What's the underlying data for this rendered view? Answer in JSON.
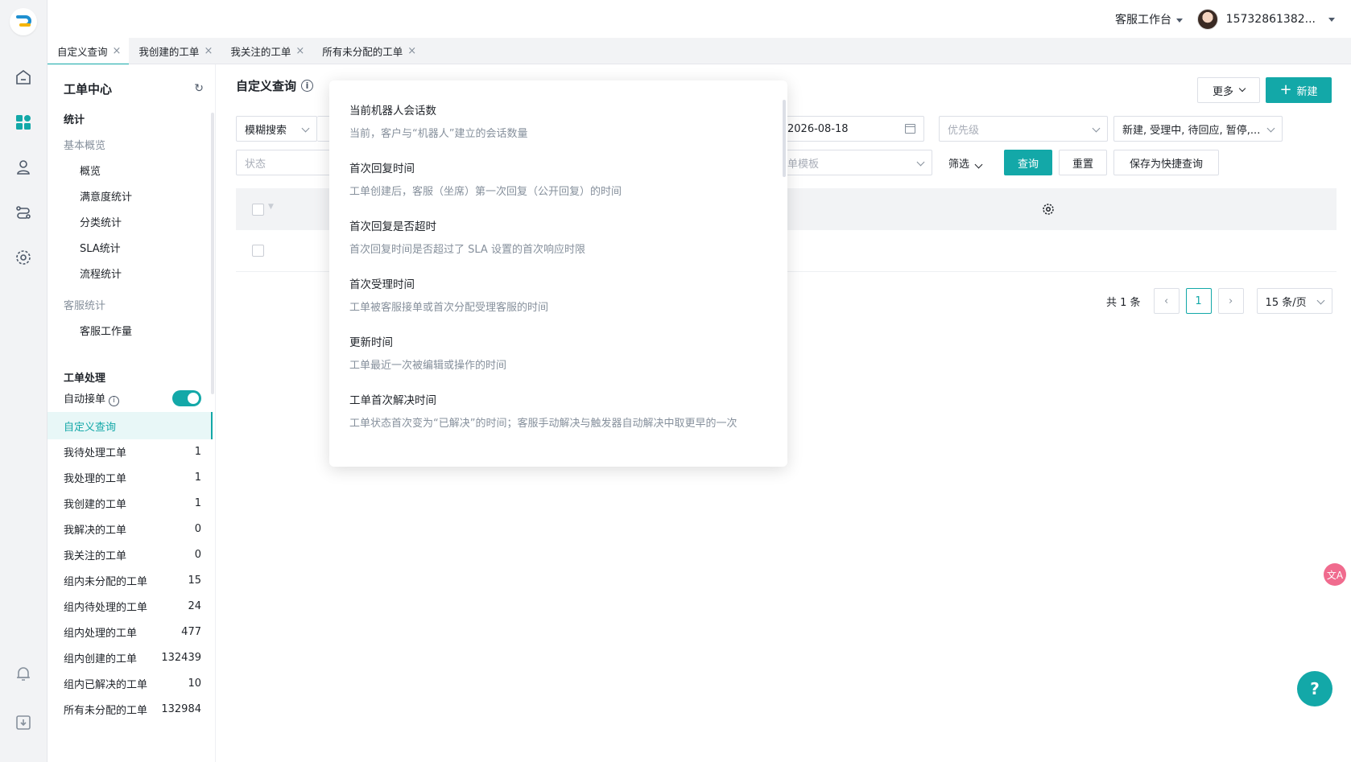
{
  "topbar": {
    "workspace": "客服工作台",
    "user": "15732861382..."
  },
  "tabs": [
    {
      "label": "自定义查询"
    },
    {
      "label": "我创建的工单"
    },
    {
      "label": "我关注的工单"
    },
    {
      "label": "所有未分配的工单"
    }
  ],
  "sidebar": {
    "title": "工单中心",
    "stats_section": "统计",
    "basic_group": "基本概览",
    "basic_items": [
      "概览",
      "满意度统计",
      "分类统计",
      "SLA统计",
      "流程统计"
    ],
    "agent_group": "客服统计",
    "agent_items": [
      "客服工作量"
    ],
    "process_section": "工单处理",
    "auto_accept": "自动接单",
    "custom_query": "自定义查询",
    "counters": [
      {
        "label": "我待处理工单",
        "count": "1"
      },
      {
        "label": "我处理的工单",
        "count": "1"
      },
      {
        "label": "我创建的工单",
        "count": "1"
      },
      {
        "label": "我解决的工单",
        "count": "0"
      },
      {
        "label": "我关注的工单",
        "count": "0"
      },
      {
        "label": "组内未分配的工单",
        "count": "15"
      },
      {
        "label": "组内待处理的工单",
        "count": "24"
      },
      {
        "label": "组内处理的工单",
        "count": "477"
      },
      {
        "label": "组内创建的工单",
        "count": "132439"
      },
      {
        "label": "组内已解决的工单",
        "count": "10"
      },
      {
        "label": "所有未分配的工单",
        "count": "132984"
      }
    ]
  },
  "main": {
    "title": "自定义查询",
    "more": "更多",
    "new": "新建",
    "search_mode": "模糊搜索",
    "date_value": "2026-08-18",
    "priority_ph": "优先级",
    "status_value": "新建, 受理中, 待回应, 暂停,...",
    "status_ph": "状态",
    "template_ph": "单模板",
    "filter": "筛选",
    "query": "查询",
    "reset": "重置",
    "save_quick": "保存为快捷查询",
    "total": "共 1 条",
    "page": "1",
    "page_size": "15 条/页"
  },
  "popover": [
    {
      "title": "当前机器人会话数",
      "desc": "当前，客户与“机器人”建立的会话数量"
    },
    {
      "title": "首次回复时间",
      "desc": "工单创建后，客服（坐席）第一次回复（公开回复）的时间"
    },
    {
      "title": "首次回复是否超时",
      "desc": "首次回复时间是否超过了 SLA 设置的首次响应时限"
    },
    {
      "title": "首次受理时间",
      "desc": "工单被客服接单或首次分配受理客服的时间"
    },
    {
      "title": "更新时间",
      "desc": "工单最近一次被编辑或操作的时间"
    },
    {
      "title": "工单首次解决时间",
      "desc": "工单状态首次变为“已解决”的时间；客服手动解决与触发器自动解决中取更早的一次"
    }
  ]
}
